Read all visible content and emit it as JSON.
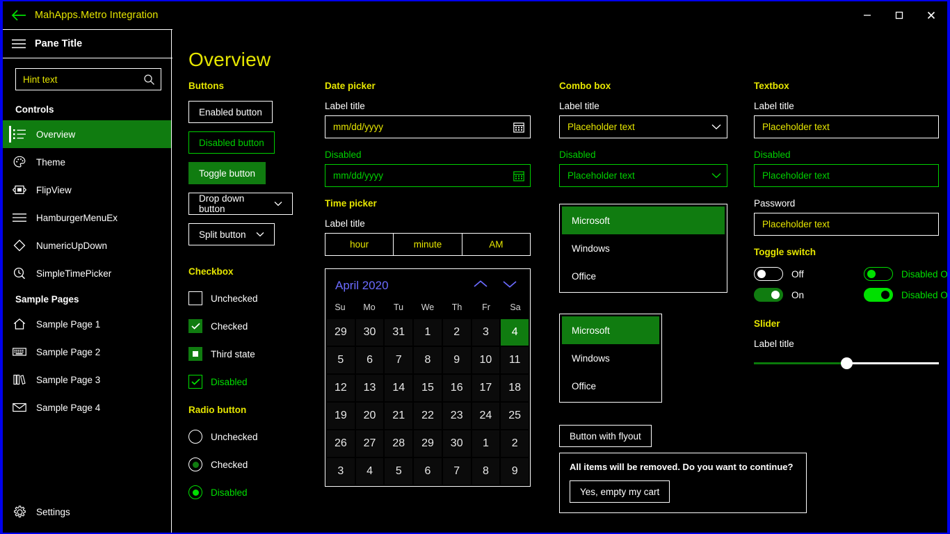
{
  "window": {
    "app_title": "MahApps.Metro Integration",
    "back_icon": "back-arrow-icon",
    "minimize_label": "–",
    "maximize_label": "□",
    "close_label": "✕"
  },
  "colors": {
    "accent_green": "#107C10",
    "disabled_green": "#00d000",
    "hint_yellow": "#e6e600",
    "window_border": "#0000ee",
    "calendar_month": "#6b6bff"
  },
  "sidebar": {
    "pane_title": "Pane Title",
    "hamburger_icon": "hamburger-icon",
    "search": {
      "value": "Hint text",
      "icon": "search-icon"
    },
    "groups": [
      {
        "title": "Controls",
        "items": [
          {
            "label": "Overview",
            "icon": "list-icon",
            "active": true
          },
          {
            "label": "Theme",
            "icon": "palette-icon",
            "active": false
          },
          {
            "label": "FlipView",
            "icon": "flipview-icon",
            "active": false
          },
          {
            "label": "HamburgerMenuEx",
            "icon": "hamburger-icon",
            "active": false
          },
          {
            "label": "NumericUpDown",
            "icon": "diamond-icon",
            "active": false
          },
          {
            "label": "SimpleTimePicker",
            "icon": "clock-icon",
            "active": false
          }
        ]
      },
      {
        "title": "Sample Pages",
        "items": [
          {
            "label": "Sample Page 1",
            "icon": "home-icon",
            "active": false
          },
          {
            "label": "Sample Page 2",
            "icon": "keyboard-icon",
            "active": false
          },
          {
            "label": "Sample Page 3",
            "icon": "books-icon",
            "active": false
          },
          {
            "label": "Sample Page 4",
            "icon": "mail-icon",
            "active": false
          }
        ]
      }
    ],
    "settings": {
      "label": "Settings",
      "icon": "gear-icon"
    }
  },
  "main": {
    "page_title": "Overview",
    "buttons": {
      "section": "Buttons",
      "enabled": "Enabled button",
      "disabled": "Disabled button",
      "toggle": "Toggle button",
      "dropdown": "Drop down button",
      "split": "Split button"
    },
    "checkbox": {
      "section": "Checkbox",
      "unchecked": "Unchecked",
      "checked": "Checked",
      "third": "Third state",
      "disabled": "Disabled"
    },
    "radio": {
      "section": "Radio button",
      "unchecked": "Unchecked",
      "checked": "Checked",
      "disabled": "Disabled"
    },
    "datepicker": {
      "section": "Date picker",
      "label": "Label title",
      "value": "mm/dd/yyyy",
      "disabled_label": "Disabled",
      "disabled_value": "mm/dd/yyyy",
      "icon": "calendar-icon"
    },
    "timepicker": {
      "section": "Time picker",
      "label": "Label title",
      "hour": "hour",
      "minute": "minute",
      "meridiem": "AM"
    },
    "calendar": {
      "month": "April 2020",
      "prev_icon": "chevron-up-icon",
      "next_icon": "chevron-down-icon",
      "dow": [
        "Su",
        "Mo",
        "Tu",
        "We",
        "Th",
        "Fr",
        "Sa"
      ],
      "selected": "4",
      "weeks": [
        [
          "29",
          "30",
          "31",
          "1",
          "2",
          "3",
          "4"
        ],
        [
          "5",
          "6",
          "7",
          "8",
          "9",
          "10",
          "11"
        ],
        [
          "12",
          "13",
          "14",
          "15",
          "16",
          "17",
          "18"
        ],
        [
          "19",
          "20",
          "21",
          "22",
          "23",
          "24",
          "25"
        ],
        [
          "26",
          "27",
          "28",
          "29",
          "30",
          "1",
          "2"
        ],
        [
          "3",
          "4",
          "5",
          "6",
          "7",
          "8",
          "9"
        ]
      ]
    },
    "combobox": {
      "section": "Combo box",
      "label": "Label title",
      "value": "Placeholder text",
      "disabled_label": "Disabled",
      "disabled_value": "Placeholder text",
      "chevron_icon": "chevron-down-icon",
      "list_a": [
        "Microsoft",
        "Windows",
        "Office"
      ],
      "list_a_selected": "Microsoft",
      "list_b": [
        "Microsoft",
        "Windows",
        "Office"
      ],
      "list_b_selected": "Microsoft"
    },
    "flyout": {
      "button": "Button with flyout",
      "message": "All items will be removed. Do you want to continue?",
      "confirm": "Yes, empty my cart"
    },
    "textbox": {
      "section": "Textbox",
      "label": "Label title",
      "value": "Placeholder text",
      "disabled_label": "Disabled",
      "disabled_value": "Placeholder text",
      "password_label": "Password",
      "password_value": "Placeholder text"
    },
    "toggleswitch": {
      "section": "Toggle switch",
      "off": "Off",
      "on": "On",
      "disabled_off": "Disabled Off",
      "disabled_on": "Disabled On"
    },
    "slider": {
      "section": "Slider",
      "label": "Label title",
      "value": 50
    }
  }
}
